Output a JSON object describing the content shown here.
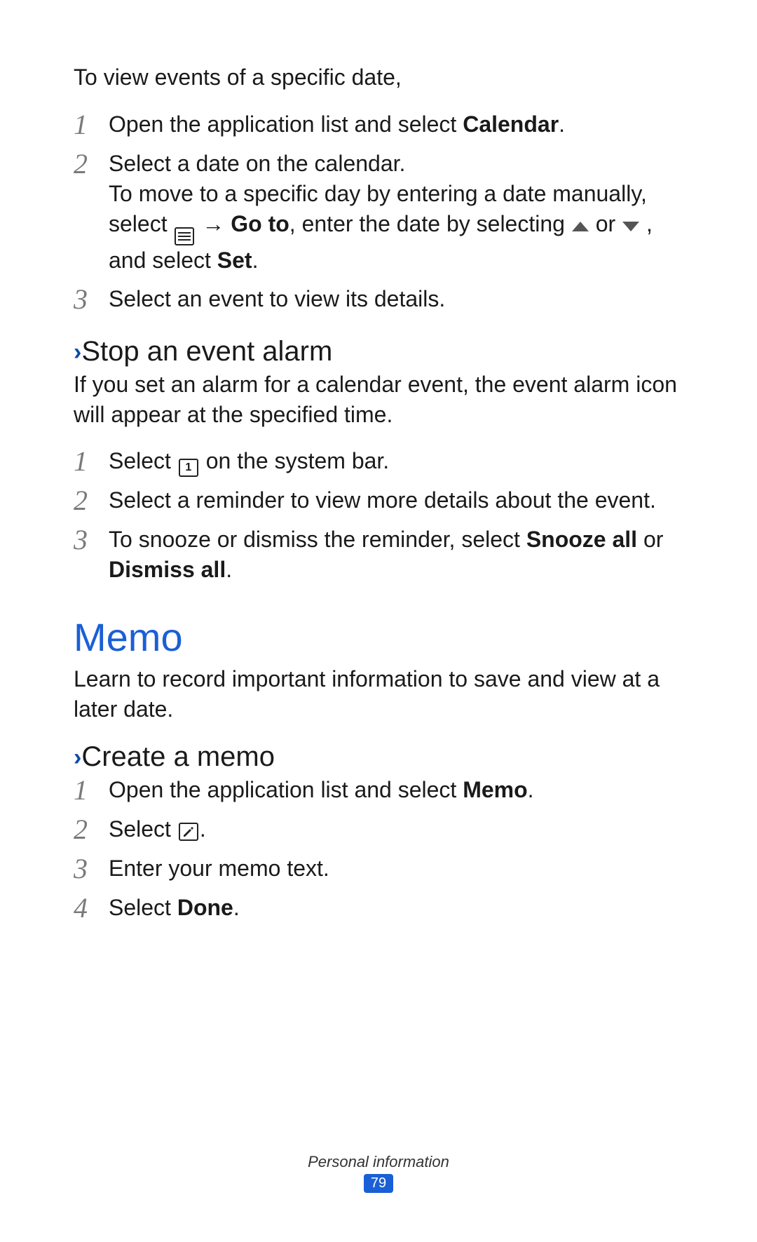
{
  "intro": "To view events of a specific date,",
  "steps_a": {
    "s1_a": "Open the application list and select ",
    "s1_b": "Calendar",
    "s1_c": ".",
    "s2_a": "Select a date on the calendar.",
    "s2_b1": "To move to a specific day by entering a date manually, select ",
    "s2_b2": " → ",
    "s2_b3": "Go to",
    "s2_b4": ", enter the date by selecting ",
    "s2_b5": " or ",
    "s2_b6": " , and select ",
    "s2_b7": "Set",
    "s2_b8": ".",
    "s3": "Select an event to view its details."
  },
  "sub1": {
    "title": "Stop an event alarm",
    "desc": "If you set an alarm for a calendar event, the event alarm icon will appear at the specified time.",
    "s1_a": "Select ",
    "s1_b": " on the system bar.",
    "s2": "Select a reminder to view more details about the event.",
    "s3_a": "To snooze or dismiss the reminder, select ",
    "s3_b": "Snooze all",
    "s3_c": " or ",
    "s3_d": "Dismiss all",
    "s3_e": "."
  },
  "memo": {
    "title": "Memo",
    "desc": "Learn to record important information to save and view at a later date."
  },
  "sub2": {
    "title": "Create a memo",
    "s1_a": "Open the application list and select ",
    "s1_b": "Memo",
    "s1_c": ".",
    "s2_a": "Select ",
    "s2_b": ".",
    "s3": "Enter your memo text.",
    "s4_a": "Select ",
    "s4_b": "Done",
    "s4_c": "."
  },
  "numbers": {
    "n1": "1",
    "n2": "2",
    "n3": "3",
    "n4": "4"
  },
  "footer": {
    "section": "Personal information",
    "page": "79"
  }
}
